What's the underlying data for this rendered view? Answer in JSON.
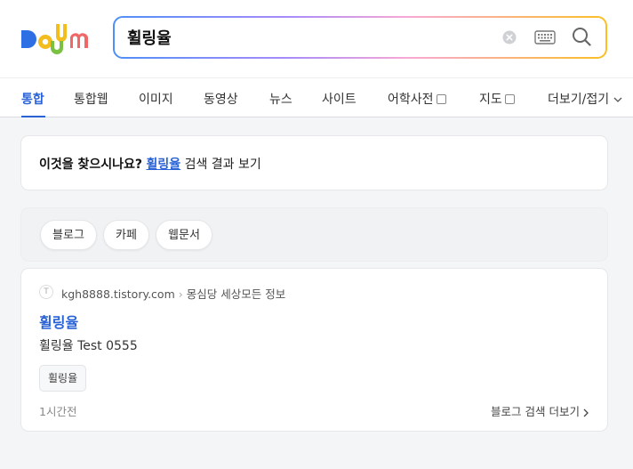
{
  "brand": {
    "logo_text": "Daum"
  },
  "search": {
    "value": "휠링율"
  },
  "tabs": [
    {
      "label": "통합",
      "active": true
    },
    {
      "label": "통합웹"
    },
    {
      "label": "이미지"
    },
    {
      "label": "동영상"
    },
    {
      "label": "뉴스"
    },
    {
      "label": "사이트"
    },
    {
      "label": "어학사전"
    },
    {
      "label": "지도"
    },
    {
      "label": "더보기/접기"
    }
  ],
  "suggestion": {
    "prefix": "이것을 찾으시나요?",
    "query": "휠링율",
    "suffix": "검색 결과 보기"
  },
  "filters": [
    "블로그",
    "카페",
    "웹문서"
  ],
  "result": {
    "favicon": "T",
    "domain": "kgh8888.tistory.com",
    "blog_name": "몽심당 세상모든 정보",
    "title": "휠링율",
    "description": "휠링율 Test 0555",
    "tag": "휠링율",
    "time": "1시간전",
    "more": "블로그 검색 더보기"
  },
  "colors": {
    "accent": "#2a63d6"
  }
}
